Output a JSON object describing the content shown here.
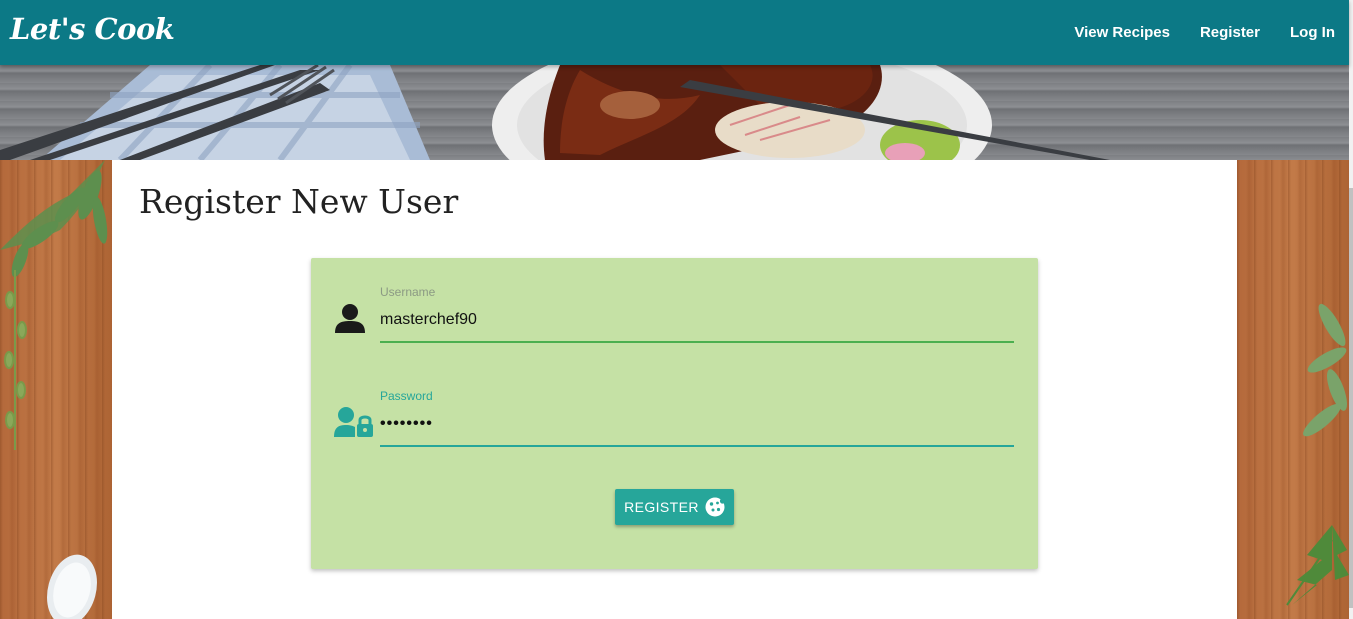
{
  "navbar": {
    "brand": "Let's Cook",
    "links": [
      "View Recipes",
      "Register",
      "Log In"
    ],
    "background": "#0c7986"
  },
  "page": {
    "title": "Register New User"
  },
  "form": {
    "username": {
      "label": "Username",
      "value": "masterchef90",
      "icon": "user-icon"
    },
    "password": {
      "label": "Password",
      "value": "••••••••",
      "icon": "user-lock-icon"
    },
    "submit": {
      "label": "REGISTER",
      "icon": "cookie-icon"
    },
    "card_color": "#c5e1a5",
    "accent": "#26a69a"
  }
}
